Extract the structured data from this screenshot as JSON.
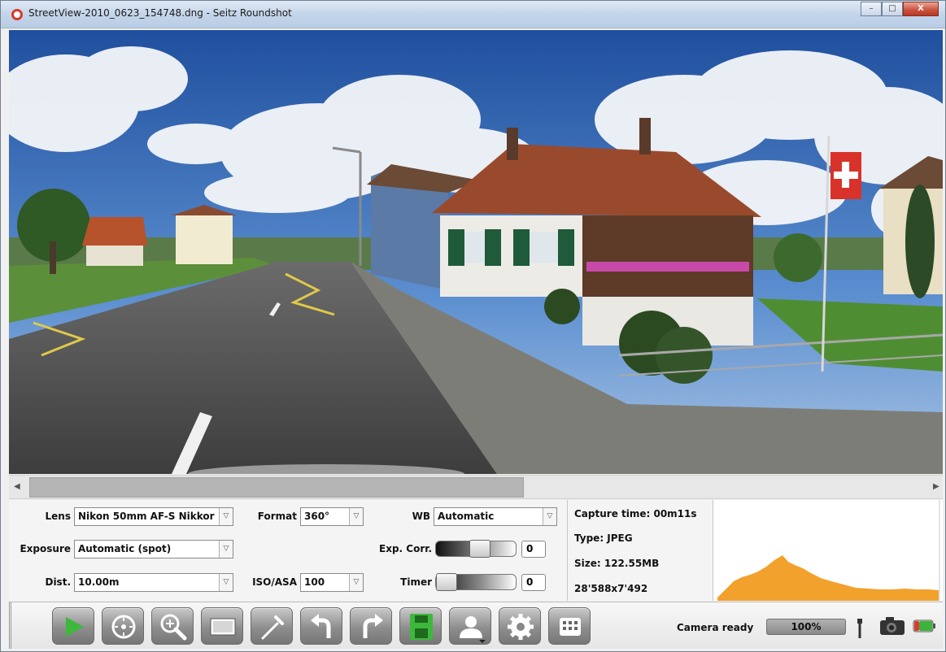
{
  "window": {
    "title": "StreetView-2010_0623_154748.dng - Seitz Roundshot",
    "minimize": "–",
    "maximize": "□",
    "close": "X"
  },
  "scrollbar": {
    "position": 0.53,
    "left_arrow": "◀",
    "right_arrow": "▶"
  },
  "settings": {
    "lens": {
      "label": "Lens",
      "value": "Nikon 50mm AF-S Nikkor"
    },
    "format": {
      "label": "Format",
      "value": "360°"
    },
    "wb": {
      "label": "WB",
      "value": "Automatic"
    },
    "exposure": {
      "label": "Exposure",
      "value": "Automatic (spot)"
    },
    "exp_corr": {
      "label": "Exp. Corr.",
      "value": "0",
      "level": 0.55
    },
    "dist": {
      "label": "Dist.",
      "value": "10.00m"
    },
    "iso": {
      "label": "ISO/ASA",
      "value": "100"
    },
    "timer": {
      "label": "Timer",
      "value": "0",
      "level": 0.0
    }
  },
  "info": {
    "capture_time": "Capture time: 00m11s",
    "type": "Type: JPEG",
    "size": "Size: 122.55MB",
    "dimensions": "28'588x7'492"
  },
  "histogram": {
    "color": "#f2a12c"
  },
  "toolbar": {
    "buttons": [
      "play-icon",
      "target-icon",
      "zoom-in-icon",
      "frame-icon",
      "pipette-icon",
      "undo-icon",
      "redo-icon",
      "save-icon",
      "user-icon",
      "settings-gear-icon",
      "grid-icon"
    ]
  },
  "status": {
    "text": "Camera ready",
    "progress_label": "100%",
    "progress": 1.0
  },
  "colors": {
    "accent_green": "#3db83d",
    "battery_green": "#3cb43c",
    "battery_red": "#d93b2f"
  }
}
